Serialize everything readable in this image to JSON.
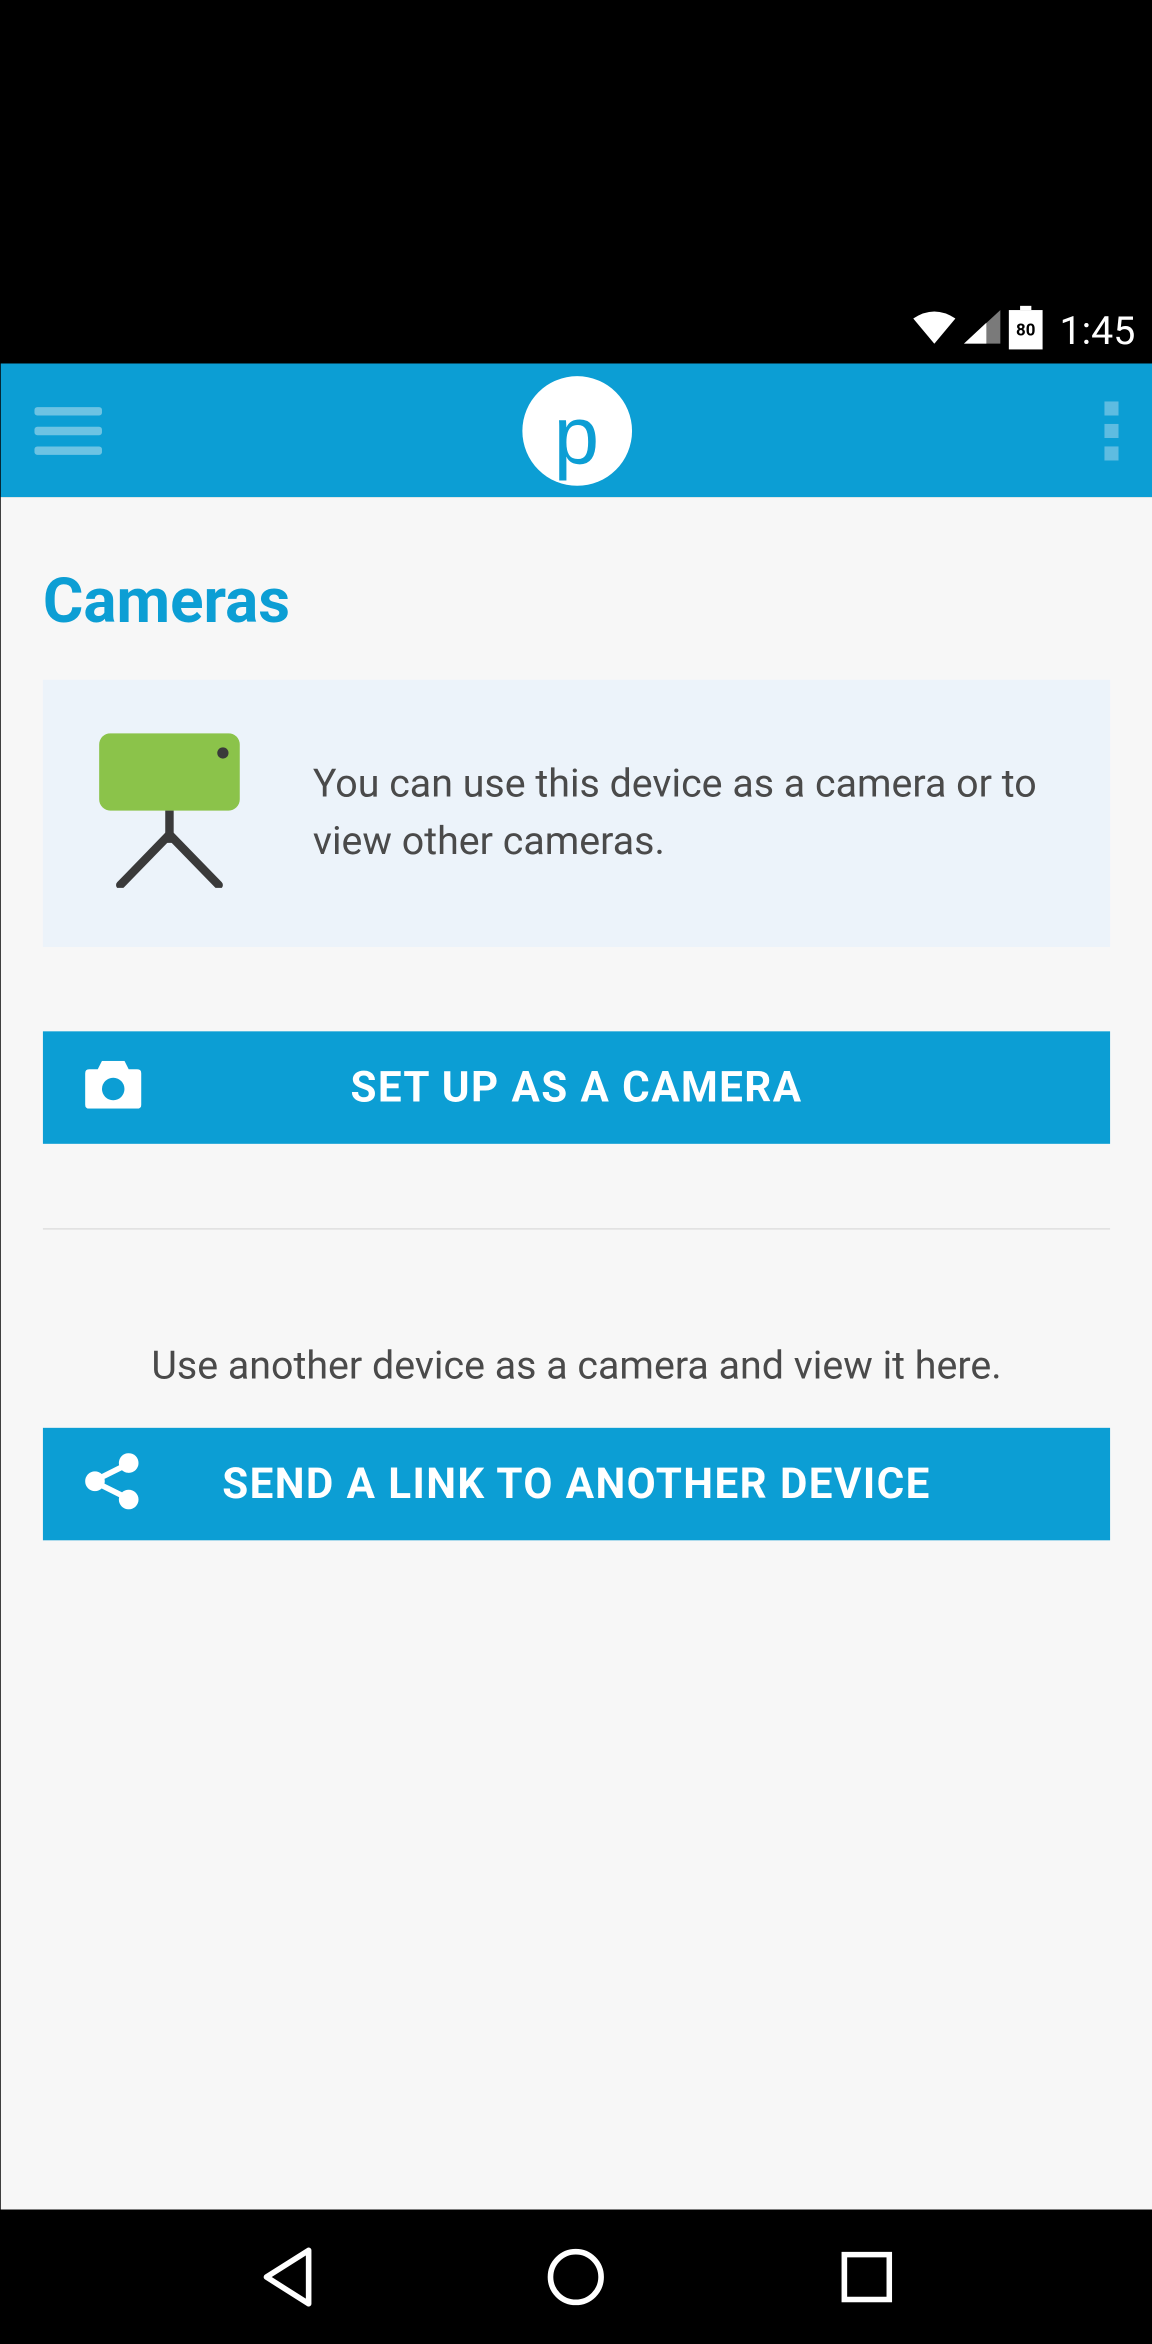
{
  "status_bar": {
    "battery_level": "80",
    "time": "1:45"
  },
  "page": {
    "title": "Cameras"
  },
  "info_card": {
    "text": "You can use this device as a camera or to view other cameras."
  },
  "buttons": {
    "setup_camera": "SET UP AS A CAMERA",
    "send_link": "SEND A LINK TO ANOTHER DEVICE"
  },
  "helper_text": "Use another device as a camera and view it here."
}
